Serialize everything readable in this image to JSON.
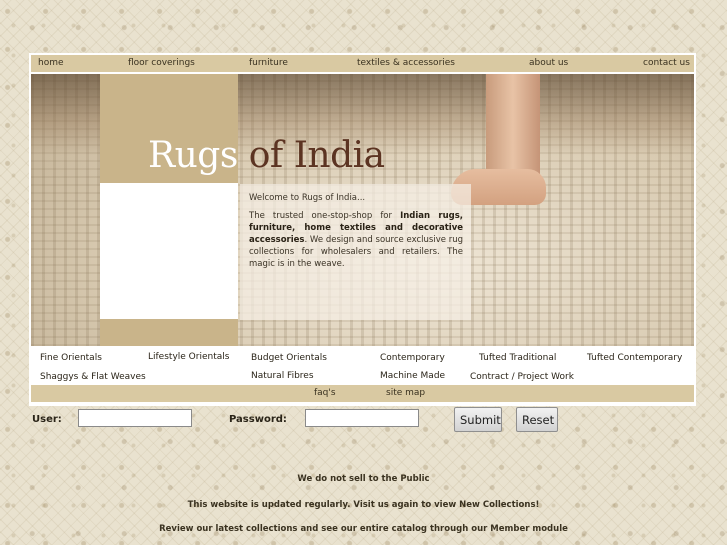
{
  "nav": {
    "items": [
      {
        "label": "home"
      },
      {
        "label": "floor coverings"
      },
      {
        "label": "furniture"
      },
      {
        "label": "textiles & accessories"
      },
      {
        "label": "about us"
      },
      {
        "label": "contact us"
      }
    ]
  },
  "brand": {
    "part1": "Rugs",
    "part2": " of India"
  },
  "welcome": {
    "title": "Welcome to Rugs of India...",
    "body_pre": "The trusted one-stop-shop for ",
    "body_bold": "Indian rugs, furniture, home textiles and decorative accessories",
    "body_post": ". We design and source exclusive rug collections for wholesalers and retailers. The magic is in the weave."
  },
  "categories": {
    "items": [
      {
        "label": "Fine Orientals"
      },
      {
        "label": "Lifestyle Orientals"
      },
      {
        "label": "Budget Orientals"
      },
      {
        "label": "Contemporary"
      },
      {
        "label": "Tufted Traditional"
      },
      {
        "label": "Tufted Contemporary"
      },
      {
        "label": "Shaggys & Flat Weaves"
      },
      {
        "label": "Natural Fibres"
      },
      {
        "label": "Machine Made"
      },
      {
        "label": "Contract / Project Work"
      }
    ]
  },
  "subnav": {
    "items": [
      {
        "label": "faq's"
      },
      {
        "label": "site map"
      }
    ]
  },
  "login": {
    "user_label": "User:",
    "password_label": "Password:",
    "user_value": "",
    "password_value": "",
    "submit_label": "Submit",
    "reset_label": "Reset"
  },
  "notes": [
    "We do not sell to the Public",
    "This website is updated regularly. Visit us again to view New Collections!",
    "Review our latest collections and see our entire catalog through our Member module"
  ],
  "colors": {
    "band": "#d9c9a2",
    "panel": "#c9b48a",
    "brand_dark": "#5c3422"
  }
}
